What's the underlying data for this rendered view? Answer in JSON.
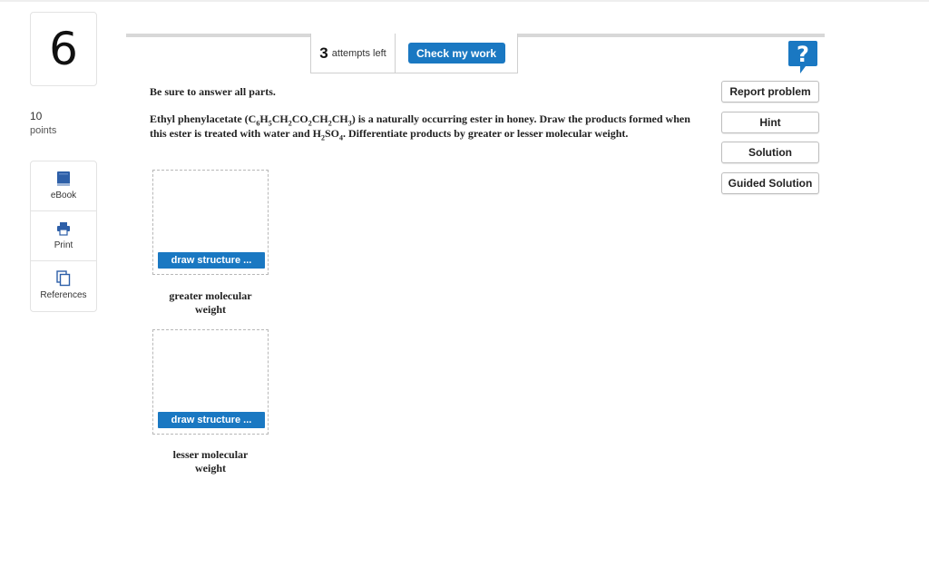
{
  "question": {
    "number": "6",
    "points_value": "10",
    "points_label": "points"
  },
  "tools": [
    {
      "label": "eBook",
      "icon": "book-icon"
    },
    {
      "label": "Print",
      "icon": "printer-icon"
    },
    {
      "label": "References",
      "icon": "references-icon"
    }
  ],
  "header": {
    "attempts_count": "3",
    "attempts_label": "attempts left",
    "check_label": "Check my work"
  },
  "side_buttons": {
    "report": "Report problem",
    "hint": "Hint",
    "solution": "Solution",
    "guided": "Guided Solution"
  },
  "content": {
    "instruction": "Be sure to answer all parts.",
    "ester_name": "Ethyl phenylacetate",
    "text_mid": " is a naturally occurring ester in honey. Draw the products formed when this ester is treated with water and ",
    "text_end": ". Differentiate products by greater or lesser molecular weight."
  },
  "answers": [
    {
      "button_label": "draw structure ...",
      "caption_line1": "greater molecular",
      "caption_line2": "weight"
    },
    {
      "button_label": "draw structure ...",
      "caption_line1": "lesser molecular",
      "caption_line2": "weight"
    }
  ],
  "colors": {
    "accent_blue": "#1a78c2"
  }
}
